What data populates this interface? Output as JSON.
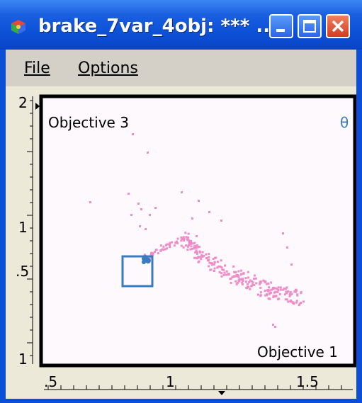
{
  "window": {
    "title": "brake_7var_4obj: *** ...",
    "icon": "app-cube-icon",
    "controls": [
      "minimize-icon",
      "maximize-icon",
      "close-icon"
    ]
  },
  "menu": {
    "file_label": "File",
    "options_label": "Options"
  },
  "plot": {
    "y_objective_label": "Objective 3",
    "x_objective_label": "Objective 1",
    "corner_marker": "θ",
    "y_ticks": [
      "2",
      "1",
      ".5",
      "1"
    ],
    "x_ticks": [
      ".5",
      "1",
      "1.5"
    ],
    "point_color": "#f08cc8",
    "selection_color": "#3a7abf"
  }
}
